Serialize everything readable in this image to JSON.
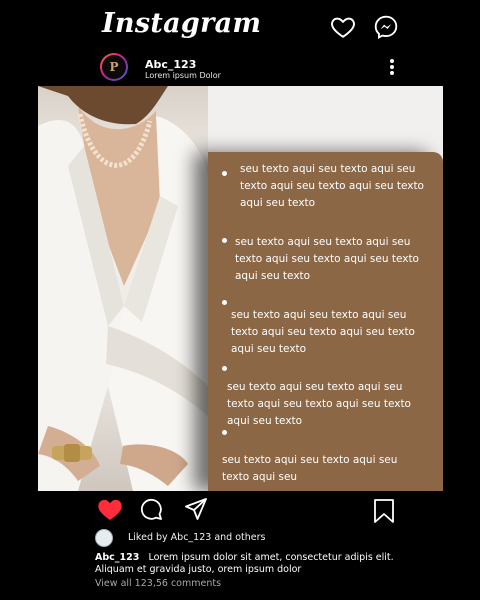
{
  "header": {
    "app_name": "Instagram",
    "icons": [
      "heart-outline-icon",
      "messenger-icon"
    ]
  },
  "profile": {
    "avatar_letter": "P",
    "username": "Abc_123",
    "subline": "Lorem ipsum Dolor",
    "menu_icon": "more-vertical-icon"
  },
  "post": {
    "items": [
      "seu texto aqui seu texto aqui seu texto aqui seu texto aqui seu texto aqui  seu texto",
      "seu texto aqui seu texto aqui seu texto aqui seu texto aqui seu texto aqui  seu texto",
      "seu texto aqui seu texto aqui seu texto aqui seu texto aqui seu texto aqui  seu texto",
      "seu texto aqui seu texto aqui seu texto aqui seu texto aqui seu texto aqui  seu texto",
      "seu texto aqui seu texto aqui seu texto aqui seu"
    ],
    "colors": {
      "panel": "#8b6746",
      "background": "#f1f0ef"
    }
  },
  "actions": {
    "like_color": "#ff2d3b",
    "icons": [
      "heart-filled-icon",
      "comment-icon",
      "share-icon",
      "bookmark-icon"
    ]
  },
  "likes": {
    "text": "Liked by Abc_123 and others"
  },
  "caption": {
    "username": "Abc_123",
    "text": "Lorem ipsum dolor sit amet, consectetur adipis elit. Aliquam et gravida justo, orem ipsum dolor"
  },
  "comments": {
    "text": "View all 123,56 comments"
  }
}
